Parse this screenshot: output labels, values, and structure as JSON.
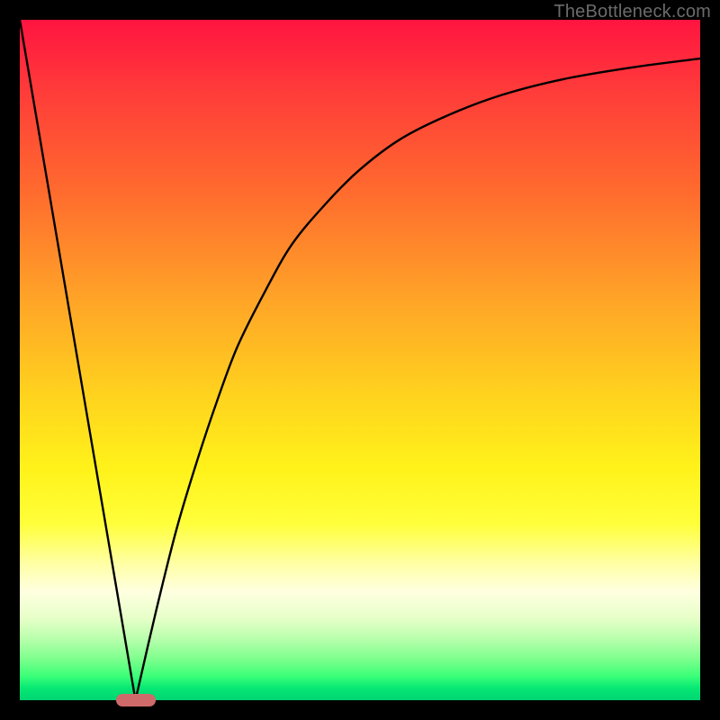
{
  "watermark": "TheBottleneck.com",
  "colors": {
    "frame": "#000000",
    "curve": "#000000",
    "marker": "#cf6a6a"
  },
  "chart_data": {
    "type": "line",
    "title": "",
    "xlabel": "",
    "ylabel": "",
    "xlim": [
      0,
      100
    ],
    "ylim": [
      0,
      100
    ],
    "grid": false,
    "series": [
      {
        "name": "left-segment",
        "x": [
          0,
          17
        ],
        "y": [
          100,
          0
        ]
      },
      {
        "name": "right-curve",
        "x": [
          17,
          20,
          23,
          26,
          29,
          32,
          36,
          40,
          45,
          50,
          56,
          63,
          71,
          80,
          90,
          100
        ],
        "y": [
          0,
          13,
          25,
          35,
          44,
          52,
          60,
          67,
          73,
          78,
          82.5,
          86,
          89,
          91.3,
          93,
          94.3
        ]
      }
    ],
    "marker": {
      "x": 17,
      "y": 0,
      "shape": "pill"
    },
    "background_gradient": {
      "direction": "vertical",
      "stops": [
        {
          "pos": 0.0,
          "color": "#ff1440"
        },
        {
          "pos": 0.1,
          "color": "#ff3a3a"
        },
        {
          "pos": 0.25,
          "color": "#ff6a2e"
        },
        {
          "pos": 0.4,
          "color": "#ffa028"
        },
        {
          "pos": 0.55,
          "color": "#ffd21e"
        },
        {
          "pos": 0.66,
          "color": "#fff21a"
        },
        {
          "pos": 0.74,
          "color": "#ffff3a"
        },
        {
          "pos": 0.8,
          "color": "#ffffa6"
        },
        {
          "pos": 0.84,
          "color": "#ffffe0"
        },
        {
          "pos": 0.88,
          "color": "#e6ffc8"
        },
        {
          "pos": 0.91,
          "color": "#b8ffac"
        },
        {
          "pos": 0.94,
          "color": "#7cff8c"
        },
        {
          "pos": 0.965,
          "color": "#3aff78"
        },
        {
          "pos": 0.982,
          "color": "#07e874"
        },
        {
          "pos": 1.0,
          "color": "#00d472"
        }
      ]
    }
  }
}
